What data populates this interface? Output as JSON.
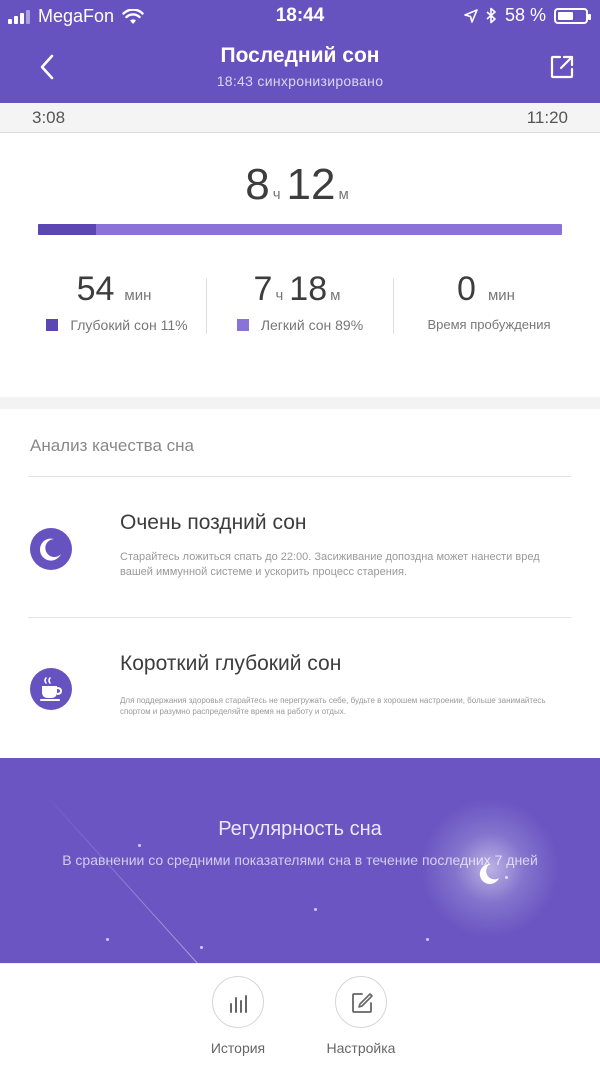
{
  "status_bar": {
    "carrier": "MegaFon",
    "time": "18:44",
    "battery": "58 %",
    "battery_level": 0.58
  },
  "header": {
    "title": "Последний сон",
    "subtitle": "18:43 синхронизировано"
  },
  "timeline": {
    "start": "3:08",
    "end": "11:20"
  },
  "total": {
    "hours": "8",
    "hours_unit": "ч",
    "minutes": "12",
    "minutes_unit": "м"
  },
  "sleep_bar": {
    "deep_fraction": 0.11,
    "deep_color": "#5c47b2",
    "light_color": "#8a72d9"
  },
  "stats": {
    "deep": {
      "value": "54",
      "unit": "мин",
      "label": "Глубокий сон 11%"
    },
    "light": {
      "hours": "7",
      "hours_unit": "ч",
      "minutes": "18",
      "minutes_unit": "м",
      "label": "Легкий сон 89%"
    },
    "awake": {
      "value": "0",
      "unit": "мин",
      "label": "Время пробуждения"
    }
  },
  "analysis": {
    "title": "Анализ качества сна",
    "items": [
      {
        "icon": "moon-icon",
        "heading": "Очень поздний сон",
        "description": "Старайтесь ложиться спать до 22:00. Засиживание допоздна может нанести вред вашей иммунной системе и ускорить процесс старения."
      },
      {
        "icon": "cup-icon",
        "heading": "Короткий глубокий сон",
        "description": "Для поддержания здоровья старайтесь не перегружать себе, будьте в хорошем настроении, больше занимайтесь спортом и разумно распределяйте время на работу и отдых."
      }
    ]
  },
  "regularity": {
    "title": "Регулярность сна",
    "subtitle": "В сравнении со средними показателями сна в течение последних 7 дней"
  },
  "tabs": [
    {
      "icon": "bar-chart-icon",
      "label": "История"
    },
    {
      "icon": "edit-icon",
      "label": "Настройка"
    }
  ],
  "colors": {
    "accent": "#6753c0"
  }
}
